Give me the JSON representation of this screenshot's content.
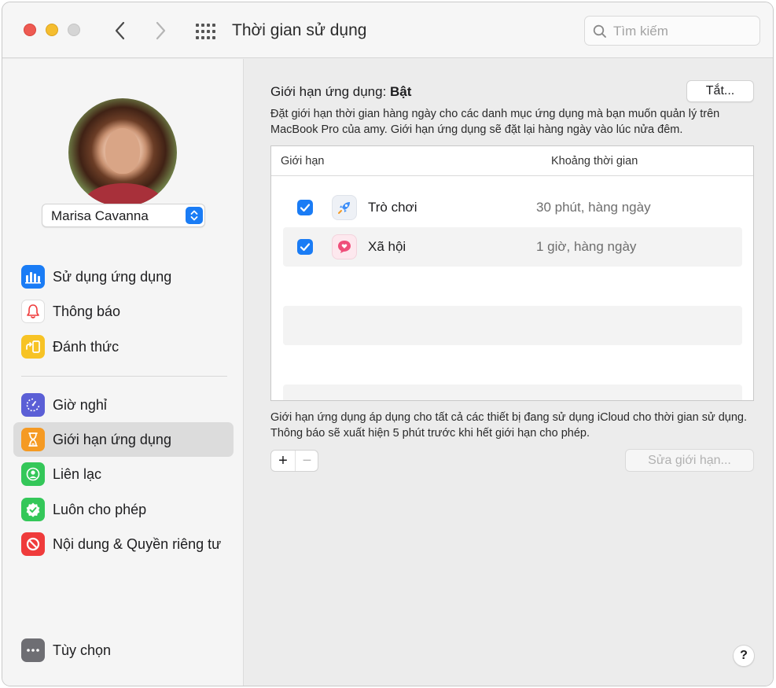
{
  "window": {
    "title": "Thời gian sử dụng",
    "search_placeholder": "Tìm kiếm"
  },
  "user": {
    "name": "Marisa Cavanna"
  },
  "sidebar": {
    "items": [
      {
        "label": "Sử dụng ứng dụng",
        "icon": "bar-chart-icon",
        "color": "#1a7cf5"
      },
      {
        "label": "Thông báo",
        "icon": "bell-icon",
        "color": "#ffffff"
      },
      {
        "label": "Đánh thức",
        "icon": "pickup-icon",
        "color": "#f7c325"
      },
      {
        "label": "Giờ nghỉ",
        "icon": "downtime-icon",
        "color": "#5b5fd6"
      },
      {
        "label": "Giới hạn ứng dụng",
        "icon": "hourglass-icon",
        "color": "#f59a23"
      },
      {
        "label": "Liên lạc",
        "icon": "contact-icon",
        "color": "#34c759"
      },
      {
        "label": "Luôn cho phép",
        "icon": "checkmark-shield-icon",
        "color": "#34c759"
      },
      {
        "label": "Nội dung & Quyền riêng tư",
        "icon": "prohibited-icon",
        "color": "#ef3b3b"
      }
    ],
    "options_label": "Tùy chọn",
    "selected_index": 4
  },
  "main": {
    "title_prefix": "Giới hạn ứng dụng:",
    "title_state": "Bật",
    "off_button": "Tắt...",
    "description": "Đặt giới hạn thời gian hàng ngày cho các danh mục ứng dụng mà bạn muốn quản lý trên MacBook Pro của amy. Giới hạn ứng dụng sẽ đặt lại hàng ngày vào lúc nửa đêm.",
    "table": {
      "col_limit": "Giới hạn",
      "col_time": "Khoảng thời gian",
      "rows": [
        {
          "name": "Trò chơi",
          "time": "30 phút, hàng ngày",
          "checked": true,
          "icon": "rocket-icon"
        },
        {
          "name": "Xã hội",
          "time": "1 giờ, hàng ngày",
          "checked": true,
          "icon": "social-bubble-icon"
        }
      ]
    },
    "note": "Giới hạn ứng dụng áp dụng cho tất cả các thiết bị đang sử dụng iCloud cho thời gian sử dụng. Thông báo sẽ xuất hiện 5 phút trước khi hết giới hạn cho phép.",
    "add_symbol": "+",
    "remove_symbol": "−",
    "edit_button": "Sửa giới hạn...",
    "help_symbol": "?"
  },
  "colors": {
    "accent": "#1a7cf5",
    "traffic_red": "#ee5a52",
    "traffic_yellow": "#f5bd2f"
  }
}
